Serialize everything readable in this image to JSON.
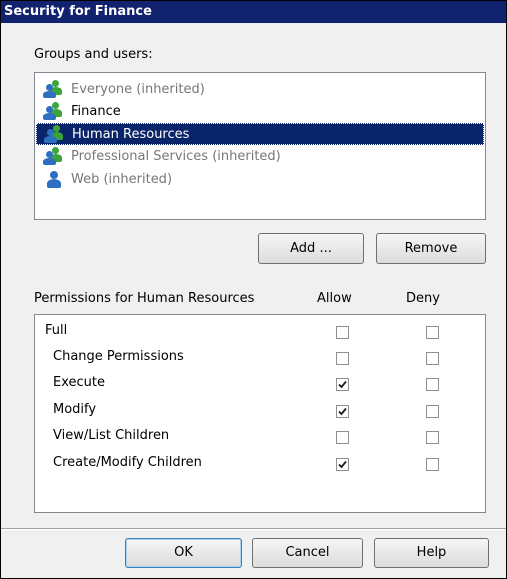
{
  "dialog": {
    "title": "Security for Finance"
  },
  "groups": {
    "label": "Groups and users:",
    "items": [
      {
        "name": "Everyone (inherited)",
        "icon": "users-group-icon",
        "inherited": true,
        "selected": false
      },
      {
        "name": "Finance",
        "icon": "users-group-icon",
        "inherited": false,
        "selected": false
      },
      {
        "name": "Human Resources",
        "icon": "users-group-icon",
        "inherited": false,
        "selected": true
      },
      {
        "name": "Professional Services (inherited)",
        "icon": "users-group-icon",
        "inherited": true,
        "selected": false
      },
      {
        "name": "Web (inherited)",
        "icon": "user-icon",
        "inherited": true,
        "selected": false
      }
    ],
    "add_label": "Add ...",
    "remove_label": "Remove"
  },
  "permissions": {
    "label": "Permissions for Human Resources",
    "allow_header": "Allow",
    "deny_header": "Deny",
    "rows": [
      {
        "name": "Full",
        "allow": false,
        "deny": false
      },
      {
        "name": "Change Permissions",
        "allow": false,
        "deny": false
      },
      {
        "name": "Execute",
        "allow": true,
        "deny": false
      },
      {
        "name": "Modify",
        "allow": true,
        "deny": false
      },
      {
        "name": "View/List Children",
        "allow": false,
        "deny": false
      },
      {
        "name": "Create/Modify Children",
        "allow": true,
        "deny": false
      }
    ]
  },
  "footer": {
    "ok_label": "OK",
    "cancel_label": "Cancel",
    "help_label": "Help"
  },
  "colors": {
    "title_bar": "#11226e",
    "selection": "#0a246a",
    "group_icon_green": "#3aa63a",
    "group_icon_blue": "#2d6fc0"
  }
}
